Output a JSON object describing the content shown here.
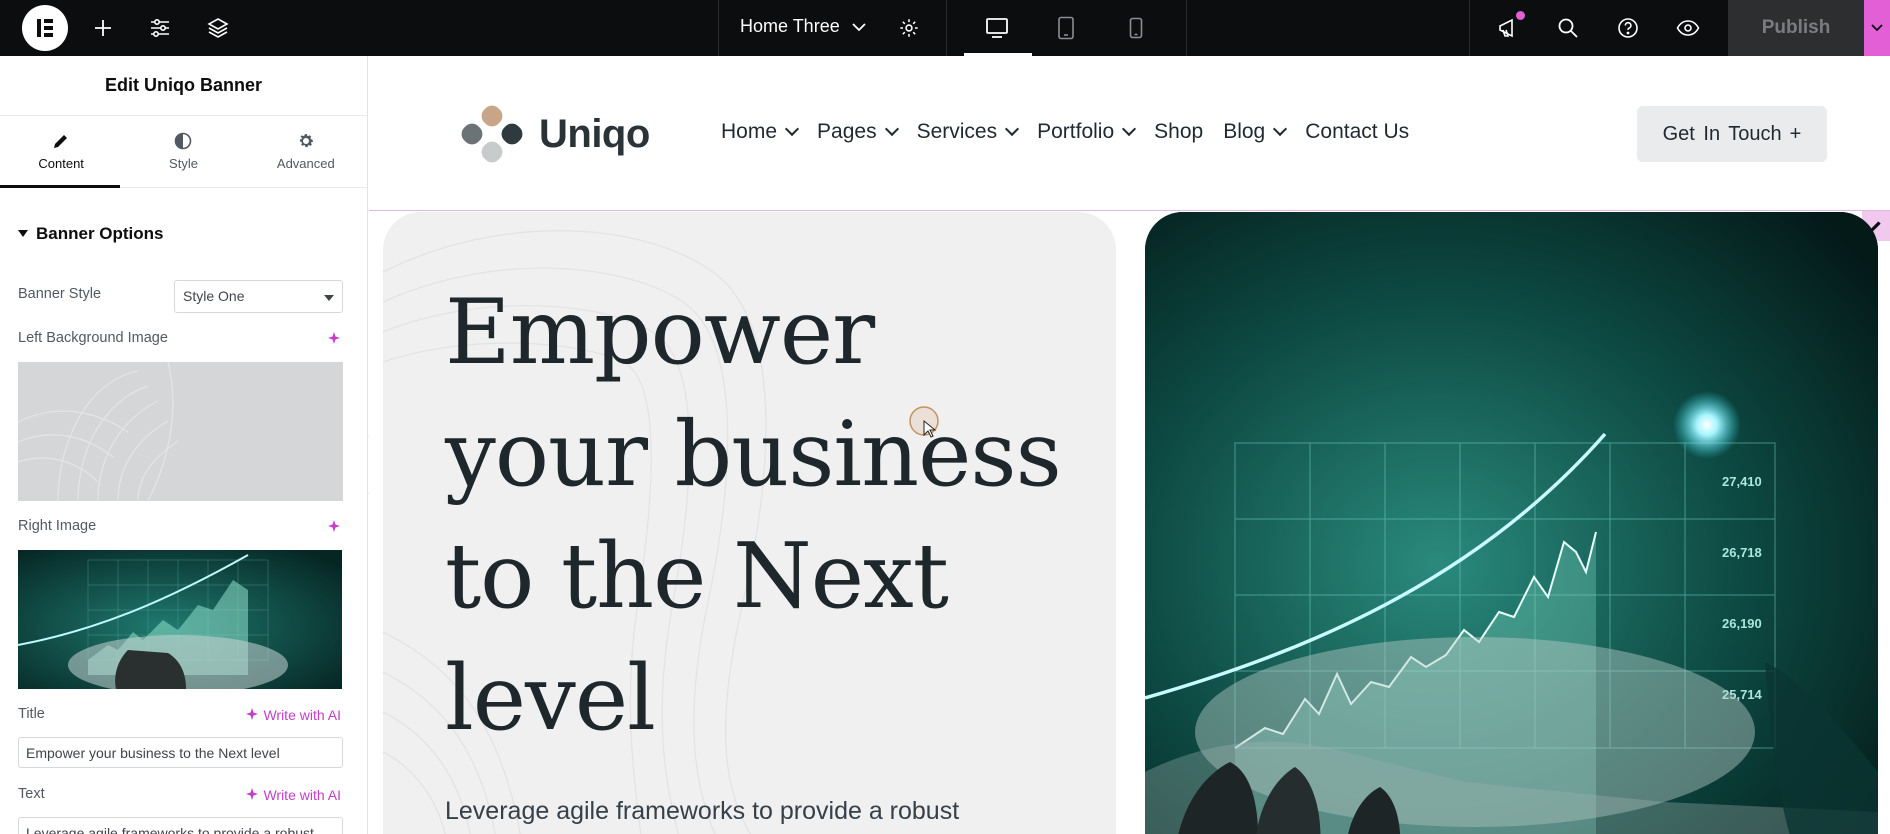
{
  "topbar": {
    "page_name": "Home Three",
    "publish_label": "Publish"
  },
  "panel": {
    "title": "Edit Uniqo Banner",
    "tabs": [
      {
        "label": "Content",
        "icon": "pencil-icon"
      },
      {
        "label": "Style",
        "icon": "half-circle-icon"
      },
      {
        "label": "Advanced",
        "icon": "gear-icon"
      }
    ],
    "section_title": "Banner Options",
    "banner_style_label": "Banner Style",
    "banner_style_value": "Style One",
    "left_bg_label": "Left Background Image",
    "right_image_label": "Right Image",
    "title_label": "Title",
    "title_value": "Empower your business to the Next level",
    "text_label": "Text",
    "text_value": "Leverage agile frameworks to provide a robust",
    "write_ai": "Write with AI"
  },
  "site": {
    "logo_text": "Uniqo",
    "nav": [
      {
        "label": "Home",
        "dropdown": true
      },
      {
        "label": "Pages",
        "dropdown": true
      },
      {
        "label": "Services",
        "dropdown": true
      },
      {
        "label": "Portfolio",
        "dropdown": true
      },
      {
        "label": "Shop",
        "dropdown": false
      },
      {
        "label": "Blog",
        "dropdown": true
      },
      {
        "label": "Contact Us",
        "dropdown": false
      }
    ],
    "cta_label": "Get In Touch",
    "cta_plus": "+",
    "hero_title_lines": [
      "Empower",
      "your business",
      "to the Next",
      "level"
    ],
    "hero_text": "Leverage agile frameworks to provide a robust",
    "chart_labels": [
      "27,410",
      "26,718",
      "26,190",
      "25,714"
    ]
  },
  "colors": {
    "accent": "#e25fd6",
    "topbar_bg": "#0c0d0e",
    "hero_left_bg": "#f0f0f0",
    "hero_right_bg": "#0a3b36"
  }
}
